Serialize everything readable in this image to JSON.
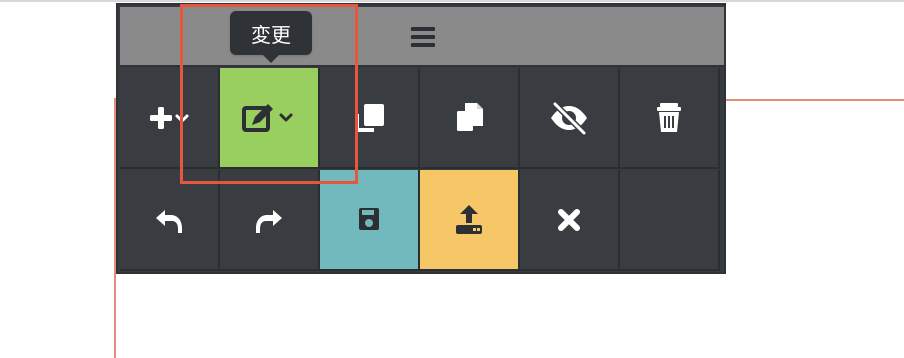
{
  "tooltip": {
    "text": "変更"
  },
  "header": {
    "menu_icon": "hamburger-icon"
  },
  "toolbar": {
    "row1": [
      {
        "id": "add",
        "icon": "plus-with-chevron-icon",
        "background": "#393c40"
      },
      {
        "id": "edit",
        "icon": "edit-with-chevron-icon",
        "background": "#98cf5f"
      },
      {
        "id": "layer",
        "icon": "layer-icon",
        "background": "#393c40"
      },
      {
        "id": "copy",
        "icon": "copy-icon",
        "background": "#393c40"
      },
      {
        "id": "hide",
        "icon": "eye-slash-icon",
        "background": "#393c40"
      },
      {
        "id": "delete",
        "icon": "trash-icon",
        "background": "#393c40"
      }
    ],
    "row2": [
      {
        "id": "undo",
        "icon": "undo-icon",
        "background": "#393c40"
      },
      {
        "id": "redo",
        "icon": "redo-icon",
        "background": "#393c40"
      },
      {
        "id": "save",
        "icon": "save-icon",
        "background": "#71b9bd"
      },
      {
        "id": "upload",
        "icon": "upload-icon",
        "background": "#f5c767"
      },
      {
        "id": "close",
        "icon": "close-icon",
        "background": "#393c40"
      },
      {
        "id": "empty",
        "icon": "",
        "background": "#393c40"
      }
    ]
  },
  "colors": {
    "toolbar_background": "#373a3e",
    "header_background": "#8a8a8a",
    "highlight_border": "#e8553e",
    "guide_line": "#e58d7b",
    "tooltip_background": "#2f3236",
    "icon_color": "#ffffff",
    "dark_icon_color": "#2c2f33"
  }
}
